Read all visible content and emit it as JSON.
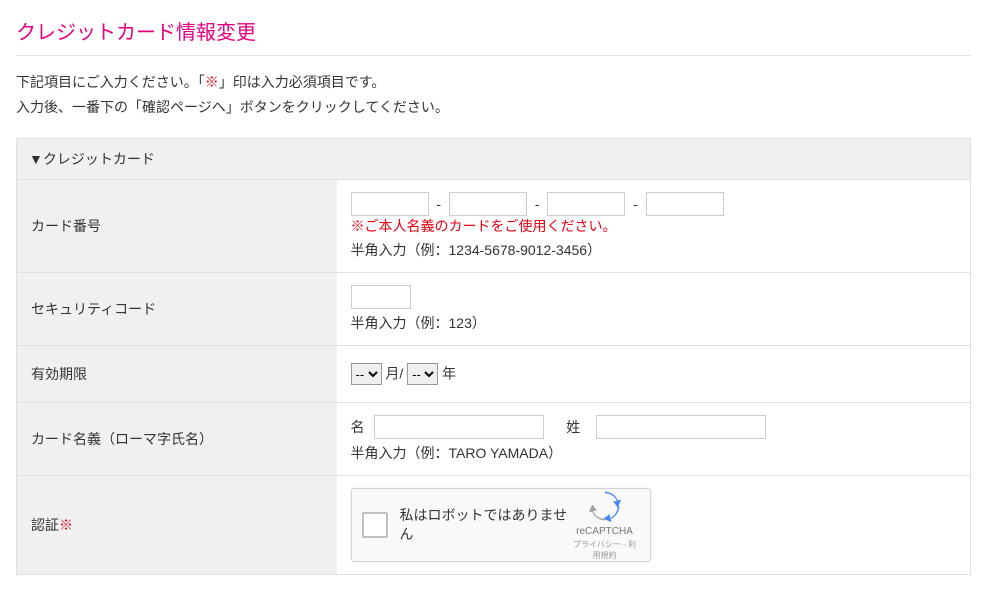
{
  "title": "クレジットカード情報変更",
  "instructions": {
    "line1_prefix": "下記項目にご入力ください。「",
    "required_symbol": "※",
    "line1_suffix": "」印は入力必須項目です。",
    "line2": "入力後、一番下の「確認ページへ」ボタンをクリックしてください。"
  },
  "section_header": "▼クレジットカード",
  "fields": {
    "card_number": {
      "label": "カード番号",
      "separator": "-",
      "warning_prefix": "※",
      "warning": "ご本人名義のカードをご使用ください。",
      "hint": "半角入力（例：1234-5678-9012-3456）"
    },
    "security_code": {
      "label": "セキュリティコード",
      "hint": "半角入力（例：123）"
    },
    "expiry": {
      "label": "有効期限",
      "placeholder": "--",
      "month_suffix": "月/",
      "year_suffix": "年"
    },
    "card_name": {
      "label": "カード名義（ローマ字氏名）",
      "first_label": "名",
      "last_label": "姓",
      "hint": "半角入力（例：TARO YAMADA）"
    },
    "captcha": {
      "label": "認証",
      "required": "※",
      "text": "私はロボットではありません",
      "brand": "reCAPTCHA",
      "links": "プライバシー - 利用規約"
    }
  }
}
